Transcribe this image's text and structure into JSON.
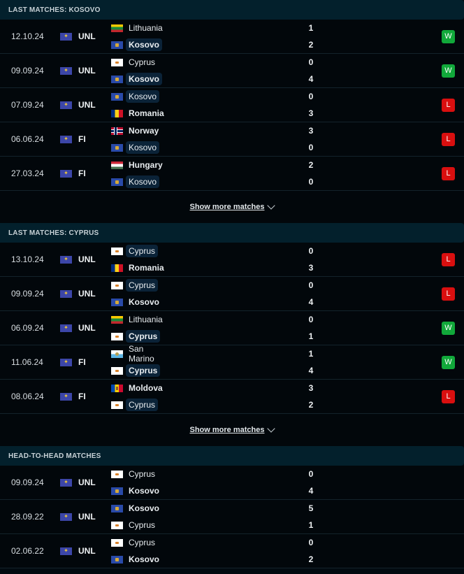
{
  "sections": [
    {
      "title": "LAST MATCHES: KOSOVO",
      "show_more": "Show more matches",
      "matches": [
        {
          "date": "12.10.24",
          "competition": "UNL",
          "home": {
            "name": "Lithuania",
            "flag": "ltu",
            "bold": false,
            "highlight": false
          },
          "away": {
            "name": "Kosovo",
            "flag": "kos",
            "bold": true,
            "highlight": true
          },
          "home_score": "1",
          "away_score": "2",
          "result": "W"
        },
        {
          "date": "09.09.24",
          "competition": "UNL",
          "home": {
            "name": "Cyprus",
            "flag": "cyp",
            "bold": false,
            "highlight": false
          },
          "away": {
            "name": "Kosovo",
            "flag": "kos",
            "bold": true,
            "highlight": true
          },
          "home_score": "0",
          "away_score": "4",
          "result": "W"
        },
        {
          "date": "07.09.24",
          "competition": "UNL",
          "home": {
            "name": "Kosovo",
            "flag": "kos",
            "bold": false,
            "highlight": true
          },
          "away": {
            "name": "Romania",
            "flag": "rou",
            "bold": true,
            "highlight": false
          },
          "home_score": "0",
          "away_score": "3",
          "result": "L"
        },
        {
          "date": "06.06.24",
          "competition": "FI",
          "home": {
            "name": "Norway",
            "flag": "nor",
            "bold": true,
            "highlight": false
          },
          "away": {
            "name": "Kosovo",
            "flag": "kos",
            "bold": false,
            "highlight": true
          },
          "home_score": "3",
          "away_score": "0",
          "result": "L"
        },
        {
          "date": "27.03.24",
          "competition": "FI",
          "home": {
            "name": "Hungary",
            "flag": "hun",
            "bold": true,
            "highlight": false
          },
          "away": {
            "name": "Kosovo",
            "flag": "kos",
            "bold": false,
            "highlight": true
          },
          "home_score": "2",
          "away_score": "0",
          "result": "L"
        }
      ]
    },
    {
      "title": "LAST MATCHES: CYPRUS",
      "show_more": "Show more matches",
      "matches": [
        {
          "date": "13.10.24",
          "competition": "UNL",
          "home": {
            "name": "Cyprus",
            "flag": "cyp",
            "bold": false,
            "highlight": true
          },
          "away": {
            "name": "Romania",
            "flag": "rou",
            "bold": true,
            "highlight": false
          },
          "home_score": "0",
          "away_score": "3",
          "result": "L"
        },
        {
          "date": "09.09.24",
          "competition": "UNL",
          "home": {
            "name": "Cyprus",
            "flag": "cyp",
            "bold": false,
            "highlight": true
          },
          "away": {
            "name": "Kosovo",
            "flag": "kos",
            "bold": true,
            "highlight": false
          },
          "home_score": "0",
          "away_score": "4",
          "result": "L"
        },
        {
          "date": "06.09.24",
          "competition": "UNL",
          "home": {
            "name": "Lithuania",
            "flag": "ltu",
            "bold": false,
            "highlight": false
          },
          "away": {
            "name": "Cyprus",
            "flag": "cyp",
            "bold": true,
            "highlight": true
          },
          "home_score": "0",
          "away_score": "1",
          "result": "W"
        },
        {
          "date": "11.06.24",
          "competition": "FI",
          "home": {
            "name": "San Marino",
            "flag": "smr",
            "bold": false,
            "highlight": false
          },
          "away": {
            "name": "Cyprus",
            "flag": "cyp",
            "bold": true,
            "highlight": true
          },
          "home_score": "1",
          "away_score": "4",
          "result": "W"
        },
        {
          "date": "08.06.24",
          "competition": "FI",
          "home": {
            "name": "Moldova",
            "flag": "mda",
            "bold": true,
            "highlight": false
          },
          "away": {
            "name": "Cyprus",
            "flag": "cyp",
            "bold": false,
            "highlight": true
          },
          "home_score": "3",
          "away_score": "2",
          "result": "L"
        }
      ]
    },
    {
      "title": "HEAD-TO-HEAD MATCHES",
      "matches": [
        {
          "date": "09.09.24",
          "competition": "UNL",
          "home": {
            "name": "Cyprus",
            "flag": "cyp",
            "bold": false,
            "highlight": false
          },
          "away": {
            "name": "Kosovo",
            "flag": "kos",
            "bold": true,
            "highlight": false
          },
          "home_score": "0",
          "away_score": "4",
          "result": ""
        },
        {
          "date": "28.09.22",
          "competition": "UNL",
          "home": {
            "name": "Kosovo",
            "flag": "kos",
            "bold": true,
            "highlight": false
          },
          "away": {
            "name": "Cyprus",
            "flag": "cyp",
            "bold": false,
            "highlight": false
          },
          "home_score": "5",
          "away_score": "1",
          "result": ""
        },
        {
          "date": "02.06.22",
          "competition": "UNL",
          "home": {
            "name": "Cyprus",
            "flag": "cyp",
            "bold": false,
            "highlight": false
          },
          "away": {
            "name": "Kosovo",
            "flag": "kos",
            "bold": true,
            "highlight": false
          },
          "home_score": "0",
          "away_score": "2",
          "result": ""
        }
      ]
    }
  ],
  "icons": {
    "competition": "world-map-icon",
    "show_more": "chevron-down-icon"
  },
  "colors": {
    "win": "#11a83a",
    "loss": "#d90f0f",
    "header_bg": "#03202c",
    "row_bg": "#02070b",
    "highlight_bg": "#0b2338"
  }
}
